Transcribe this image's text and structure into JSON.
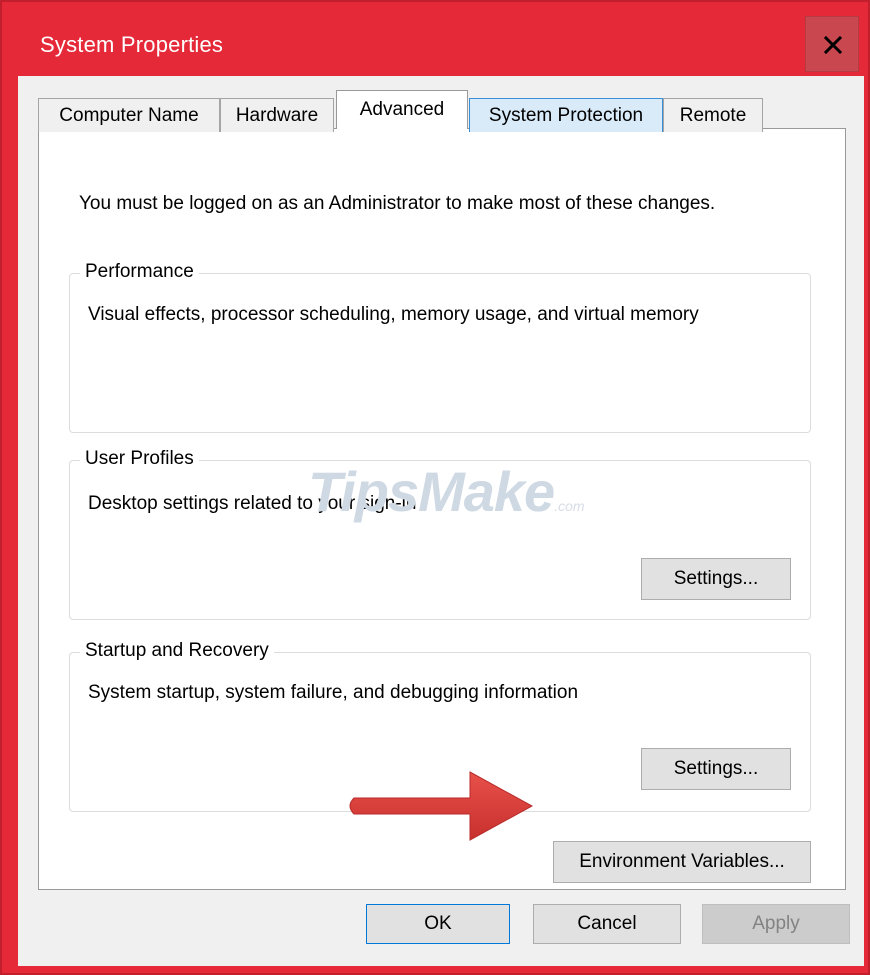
{
  "window": {
    "title": "System Properties",
    "close_glyph": "×",
    "accent_color": "#e52938"
  },
  "tabs": [
    {
      "label": "Computer Name",
      "state": "normal"
    },
    {
      "label": "Hardware",
      "state": "normal"
    },
    {
      "label": "Advanced",
      "state": "selected"
    },
    {
      "label": "System Protection",
      "state": "hover"
    },
    {
      "label": "Remote",
      "state": "normal"
    }
  ],
  "advanced": {
    "notice": "You must be logged on as an Administrator to make most of these changes.",
    "performance": {
      "legend": "Performance",
      "description": "Visual effects, processor scheduling, memory usage, and virtual memory"
    },
    "user_profiles": {
      "legend": "User Profiles",
      "description": "Desktop settings related to your sign-in",
      "settings_label": "Settings..."
    },
    "startup_recovery": {
      "legend": "Startup and Recovery",
      "description": "System startup, system failure, and debugging information",
      "settings_label": "Settings..."
    },
    "env_vars_label": "Environment Variables..."
  },
  "watermark": {
    "brand": "TipsMake",
    "tld": ".com"
  },
  "annotation": {
    "arrow_icon": "red-arrow-right-icon",
    "arrow_color": "#e03c3c"
  },
  "footer": {
    "ok_label": "OK",
    "cancel_label": "Cancel",
    "apply_label": "Apply"
  }
}
